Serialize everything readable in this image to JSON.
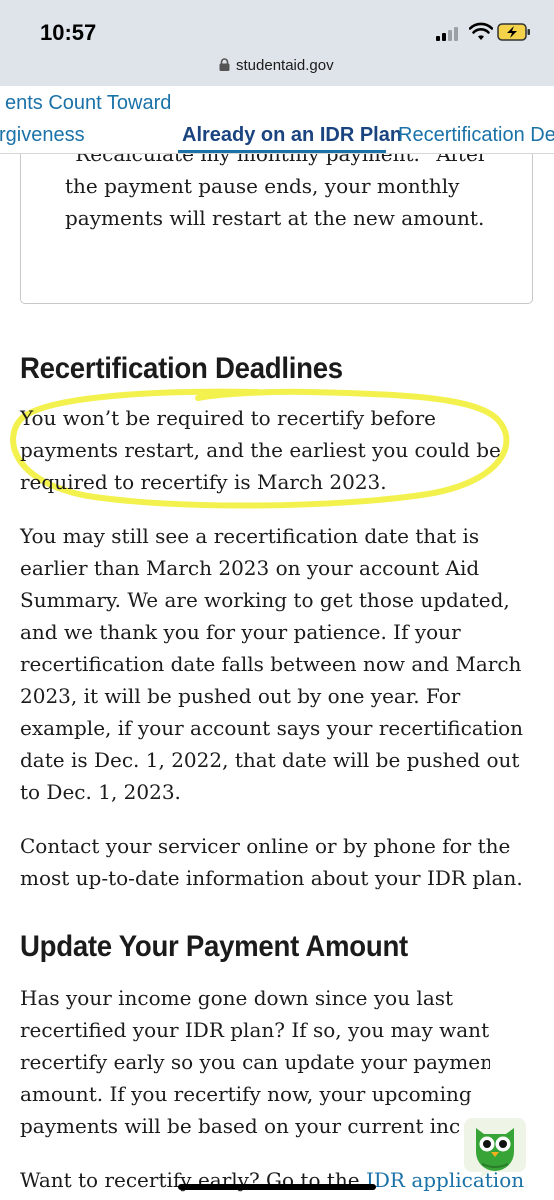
{
  "status_bar": {
    "time": "10:57"
  },
  "browser": {
    "url": "studentaid.gov"
  },
  "tabs": [
    {
      "label_line1": "ents Count Toward",
      "label_line2": "rgiveness"
    },
    {
      "label": "Already on an IDR Plan"
    },
    {
      "label": "Recertification De"
    }
  ],
  "card": {
    "text": "“Recalculate my monthly payment.” After the payment pause ends, your monthly payments will restart at the new amount."
  },
  "section_recert": {
    "heading": "Recertification Deadlines",
    "para1": "You won’t be required to recertify before payments restart, and the earliest you could be required to recertify is March 2023.",
    "para2": "You may still see a recertification date that is earlier than March 2023 on your account Aid Summary. We are working to get those updated, and we thank you for your patience. If your recertification date falls between now and March 2023, it will be pushed out by one year. For example, if your account says your recertification date is Dec. 1, 2022, that date will be pushed out to Dec. 1, 2023.",
    "para3": "Contact your servicer online or by phone for the most up-to-date information about your IDR plan."
  },
  "section_update": {
    "heading": "Update Your Payment Amount",
    "para1": "Has your income gone down since you last recertified your IDR plan? If so, you may want to recertify early so you can update your payment amount. If you recertify now, your upcoming payments will be based on your current inc",
    "para2_prefix": "Want to recertify early? Go to the ",
    "para2_link": "IDR application"
  },
  "colors": {
    "link": "#1a72a8",
    "highlight": "#f2f03a",
    "status_bar_bg": "#dfe4ea"
  },
  "icons": [
    "lock-icon",
    "signal-icon",
    "wifi-icon",
    "battery-icon",
    "owl-icon"
  ]
}
